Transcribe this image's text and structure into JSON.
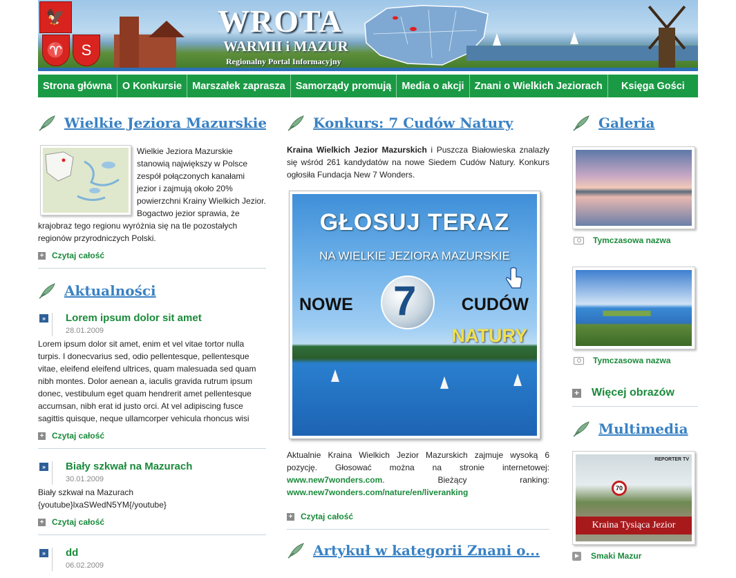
{
  "header": {
    "title": "WROTA",
    "subtitle": "WARMII i MAZUR",
    "tagline": "Regionalny Portal Informacyjny"
  },
  "nav": [
    {
      "label": "Strona główna"
    },
    {
      "label": "O Konkursie"
    },
    {
      "label": "Marszałek zaprasza"
    },
    {
      "label": "Samorządy promują"
    },
    {
      "label": "Media o akcji"
    },
    {
      "label": "Znani o Wielkich Jeziorach"
    },
    {
      "label": "Księga Gości"
    }
  ],
  "left": {
    "section1": {
      "title": "Wielkie Jeziora Mazurskie",
      "body": "Wielkie Jeziora Mazurskie stanowią największy w Polsce zespół połączonych kanałami jezior i zajmują około 20% powierzchni Krainy Wielkich Jezior. Bogactwo jezior sprawia, że krajobraz tego regionu wyróżnia się na tle pozostałych regionów przyrodniczych Polski.",
      "more": "Czytaj całość"
    },
    "section2": {
      "title": "Aktualności",
      "items": [
        {
          "title": "Lorem ipsum dolor sit amet",
          "date": "28.01.2009",
          "body": "Lorem ipsum dolor sit amet, enim et vel vitae tortor nulla turpis.  I donecvarius sed, odio pellentesque, pellentesque vitae, eleifend eleifend ultrices, quam malesuada sed quam nibh montes. Dolor aenean a, iaculis gravida rutrum ipsum donec, vestibulum eget quam hendrerit amet pellentesque accumsan, nibh erat id justo orci. At vel adipiscing fusce sagittis quisque, neque ullamcorper vehicula rhoncus wisi",
          "more": "Czytaj całość"
        },
        {
          "title": "Biały szkwał na Mazurach",
          "date": "30.01.2009",
          "body_line1": "Biały szkwał na Mazurach",
          "body_line2": "{youtube}lxaSWedN5YM{/youtube}",
          "more": "Czytaj całość"
        },
        {
          "title": "dd",
          "date": "06.02.2009"
        }
      ]
    }
  },
  "middle": {
    "section1": {
      "title": "Konkurs: 7 Cudów Natury",
      "intro_bold": "Kraina Wielkich Jezior Mazurskich",
      "intro_rest": " i Puszcza Białowieska znalazły się wśród 261 kandydatów na nowe Siedem Cudów Natury. Konkurs ogłosiła Fundacja New 7 Wonders.",
      "banner": {
        "line1": "GŁOSUJ TERAZ",
        "line2": "NA WIELKIE JEZIORA MAZURSKIE",
        "word_left": "NOWE",
        "numeral": "7",
        "word_right": "CUDÓW",
        "word_bottom": "NATURY"
      },
      "body_text": "Aktualnie Kraina Wielkich Jezior Mazurskich zajmuje wysoką 6 pozycję. Głosować można na stronie internetowej: ",
      "link1": "www.new7wonders.com",
      "body_mid": ". Bieżący ranking: ",
      "link2": "www.new7wonders.com/nature/en/liveranking",
      "more": "Czytaj całość"
    },
    "section2": {
      "title": "Artykuł w kategorii Znani o..."
    }
  },
  "right": {
    "gallery": {
      "title": "Galeria",
      "items": [
        {
          "caption": "Tymczasowa nazwa"
        },
        {
          "caption": "Tymczasowa nazwa"
        }
      ],
      "more": "Więcej obrazów"
    },
    "multimedia": {
      "title": "Multimedia",
      "video_overlay": "Kraina Tysiąca Jezior",
      "video_sign": "70",
      "video_logo": "REPORTER TV",
      "video_title": "Smaki Mazur"
    }
  },
  "colors": {
    "nav_bg": "#1a9a44",
    "heading_blue": "#3a82c4",
    "link_green": "#1a8a3a"
  }
}
